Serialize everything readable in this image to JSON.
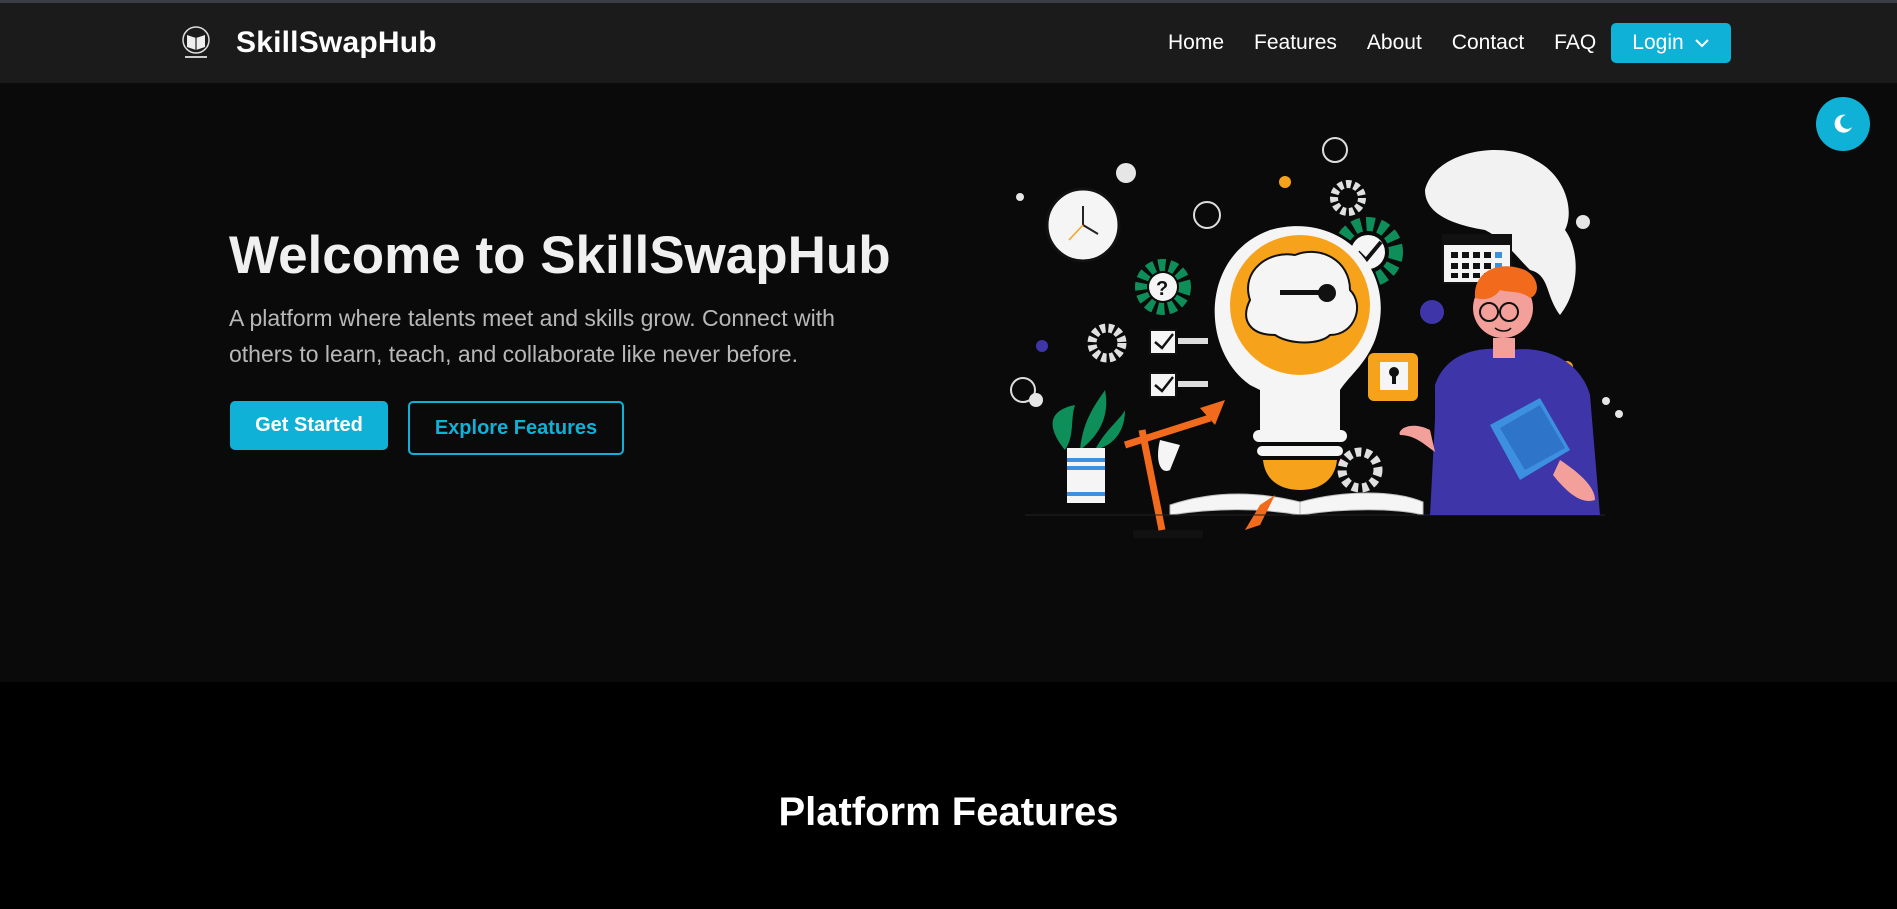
{
  "navbar": {
    "brand_name": "SkillSwapHub",
    "logo_icon": "book-logo-icon",
    "links": [
      {
        "label": "Home"
      },
      {
        "label": "Features"
      },
      {
        "label": "About"
      },
      {
        "label": "Contact"
      },
      {
        "label": "FAQ"
      }
    ],
    "login_label": "Login",
    "login_icon": "chevron-down-icon"
  },
  "theme_toggle": {
    "icon": "moon-icon"
  },
  "hero": {
    "title": "Welcome to SkillSwapHub",
    "subtitle": "A platform where talents meet and skills grow. Connect with others to learn, teach, and collaborate like never before.",
    "primary_button": "Get Started",
    "secondary_button": "Explore Features",
    "illustration": "lightbulb-learning-illustration"
  },
  "features_section": {
    "title": "Platform Features"
  },
  "colors": {
    "accent": "#0fb2d6",
    "navbar_bg": "#1b1b1b",
    "hero_bg": "#0a0a0a",
    "page_bg": "#000000",
    "illustration_orange": "#f7a21b",
    "illustration_green": "#0e8f5a",
    "illustration_purple": "#3d35a8"
  }
}
